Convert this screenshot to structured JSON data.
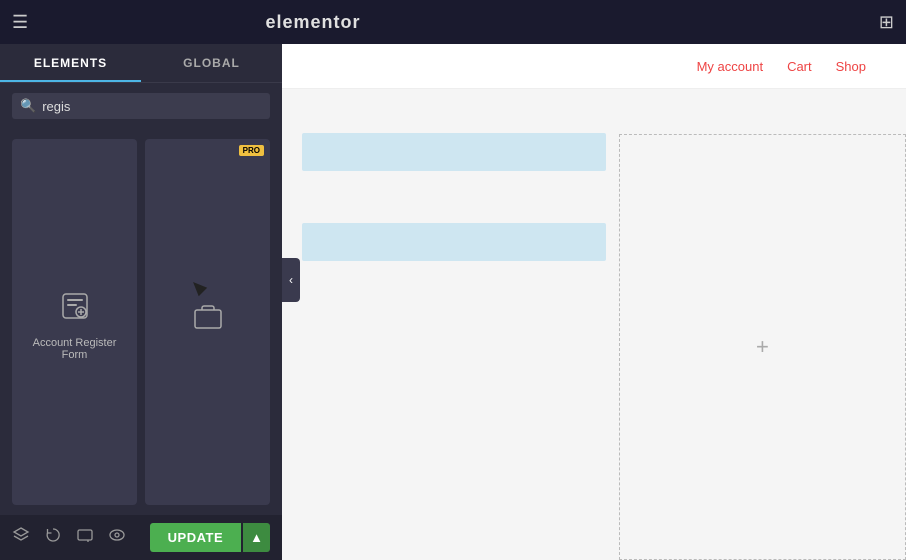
{
  "topbar": {
    "hamburger_label": "☰",
    "title": "elementor",
    "grid_label": "⊞"
  },
  "sidebar": {
    "tabs": [
      {
        "id": "elements",
        "label": "ELEMENTS",
        "active": true
      },
      {
        "id": "global",
        "label": "GLOBAL",
        "active": false
      }
    ],
    "search": {
      "placeholder": "regis",
      "value": "regis",
      "icon": "🔍"
    },
    "widgets": [
      {
        "id": "account-register-form",
        "label": "Account Register Form",
        "icon": "📋",
        "pro": false
      },
      {
        "id": "widget2",
        "label": "",
        "icon": "🛒",
        "pro": true
      }
    ],
    "footer": {
      "icons": [
        "⬆",
        "↺",
        "◻",
        "👁"
      ],
      "update_label": "UPDATE",
      "dropdown_icon": "▲"
    }
  },
  "page": {
    "nav_links": [
      {
        "label": "My account",
        "id": "my-account"
      },
      {
        "label": "Cart",
        "id": "cart"
      },
      {
        "label": "Shop",
        "id": "shop"
      }
    ],
    "placeholder_plus": "+"
  },
  "colors": {
    "accent_blue": "#4db6e5",
    "nav_link_red": "#e44444",
    "green_update": "#4caf50",
    "blue_block": "#bde0f0"
  }
}
